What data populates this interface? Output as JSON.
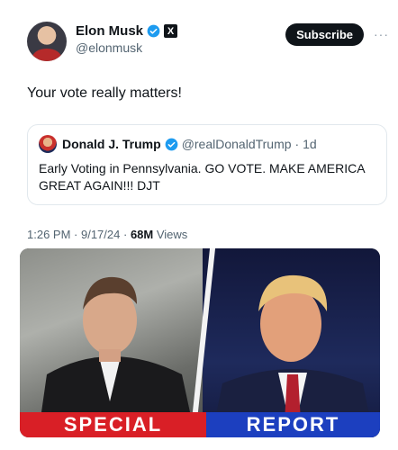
{
  "author": {
    "name": "Elon Musk",
    "handle": "@elonmusk"
  },
  "actions": {
    "subscribe_label": "Subscribe",
    "more_label": "···"
  },
  "tweet": {
    "text": "Your vote really matters!"
  },
  "quote": {
    "name": "Donald J. Trump",
    "handle": "@realDonaldTrump",
    "time": "· 1d",
    "text": "Early Voting in Pennsylvania. GO VOTE. MAKE AMERICA GREAT AGAIN!!! DJT"
  },
  "meta": {
    "time": "1:26 PM",
    "date": "· 9/17/24 ·",
    "views_count": "68M",
    "views_label": "Views"
  },
  "media": {
    "banner_left": "SPECIAL",
    "banner_right": "REPORT"
  },
  "colors": {
    "verified": "#1d9bf0",
    "banner_red": "#d91f26",
    "banner_blue": "#1c3fbf"
  }
}
